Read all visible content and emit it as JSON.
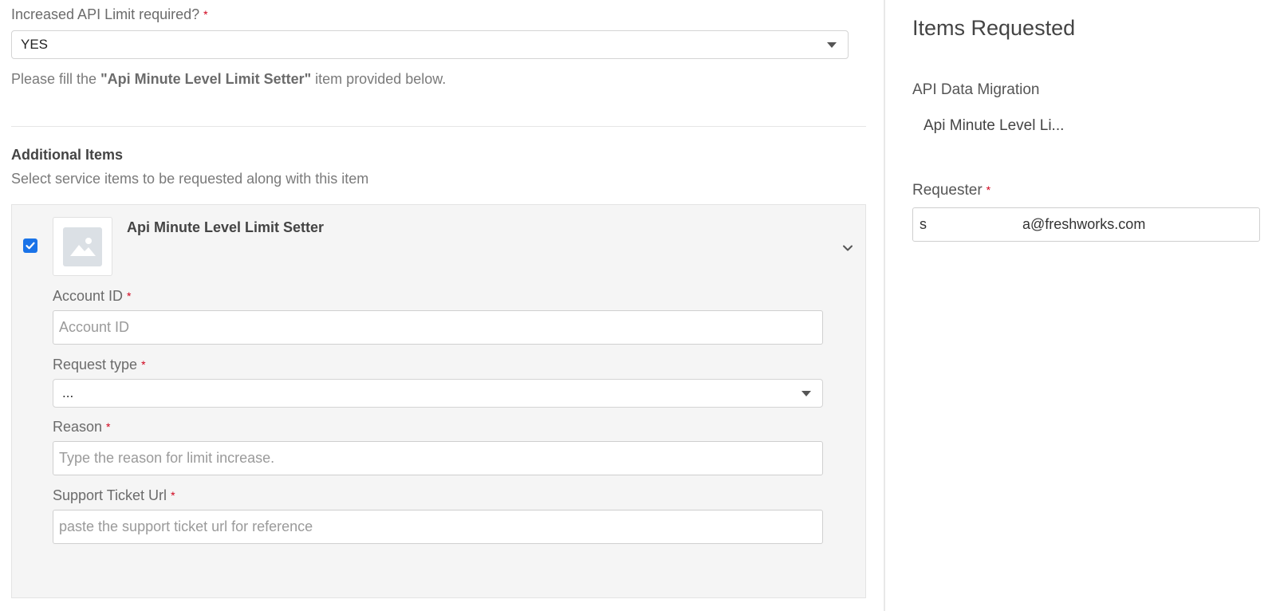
{
  "form": {
    "api_limit": {
      "label": "Increased API Limit required?",
      "required_mark": "*",
      "value": "YES"
    },
    "note": {
      "prefix": "Please fill the ",
      "highlight": "\"Api Minute Level Limit Setter\"",
      "suffix": " item provided below."
    },
    "additional_items": {
      "title": "Additional Items",
      "subtitle": "Select service items to be requested along with this item"
    },
    "item_card": {
      "checked": true,
      "title": "Api Minute Level Limit Setter",
      "fields": {
        "account_id": {
          "label": "Account ID",
          "required_mark": "*",
          "placeholder": "Account ID",
          "value": ""
        },
        "request_type": {
          "label": "Request type",
          "required_mark": "*",
          "value": "..."
        },
        "reason": {
          "label": "Reason",
          "required_mark": "*",
          "placeholder": "Type the reason for limit increase.",
          "value": ""
        },
        "support_url": {
          "label": "Support Ticket Url",
          "required_mark": "*",
          "placeholder": "paste the support ticket url for reference",
          "value": ""
        }
      }
    }
  },
  "sidebar": {
    "title": "Items Requested",
    "group": "API Data Migration",
    "item": "Api Minute Level Li...",
    "requester": {
      "label": "Requester",
      "required_mark": "*",
      "value_start": "s",
      "value_end": "a@freshworks.com"
    }
  },
  "colors": {
    "required": "#d0021b",
    "checkbox": "#1a73e8",
    "card_bg": "#f5f5f5"
  },
  "icons": [
    "dropdown-caret-icon",
    "checkmark-icon",
    "image-placeholder-icon",
    "chevron-down-icon"
  ]
}
